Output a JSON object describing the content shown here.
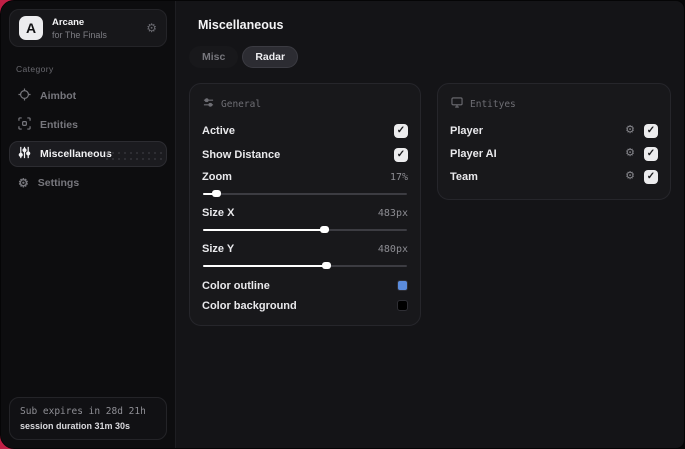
{
  "brand": {
    "initial": "A",
    "name": "Arcane",
    "subtitle": "for The Finals"
  },
  "sidebar": {
    "section_label": "Category",
    "items": [
      {
        "label": "Aimbot"
      },
      {
        "label": "Entities"
      },
      {
        "label": "Miscellaneous"
      },
      {
        "label": "Settings"
      }
    ],
    "footer": {
      "sub_expires": "Sub expires in 28d 21h",
      "session_duration": "session duration 31m 30s"
    }
  },
  "main": {
    "title": "Miscellaneous",
    "tabs": [
      {
        "label": "Misc",
        "active": false
      },
      {
        "label": "Radar",
        "active": true
      }
    ],
    "general": {
      "title": "General",
      "rows": {
        "active": {
          "label": "Active",
          "checked": true
        },
        "show_distance": {
          "label": "Show Distance",
          "checked": true
        },
        "zoom": {
          "label": "Zoom",
          "value": "17%",
          "percent": 7
        },
        "size_x": {
          "label": "Size X",
          "value": "483px",
          "percent": 59
        },
        "size_y": {
          "label": "Size Y",
          "value": "480px",
          "percent": 60
        },
        "color_outline": {
          "label": "Color outline",
          "color": "#5b8cdd"
        },
        "color_background": {
          "label": "Color background",
          "color": "#000000"
        }
      }
    },
    "entities": {
      "title": "Entityes",
      "rows": [
        {
          "label": "Player",
          "checked": true
        },
        {
          "label": "Player AI",
          "checked": true
        },
        {
          "label": "Team",
          "checked": true
        }
      ]
    }
  }
}
